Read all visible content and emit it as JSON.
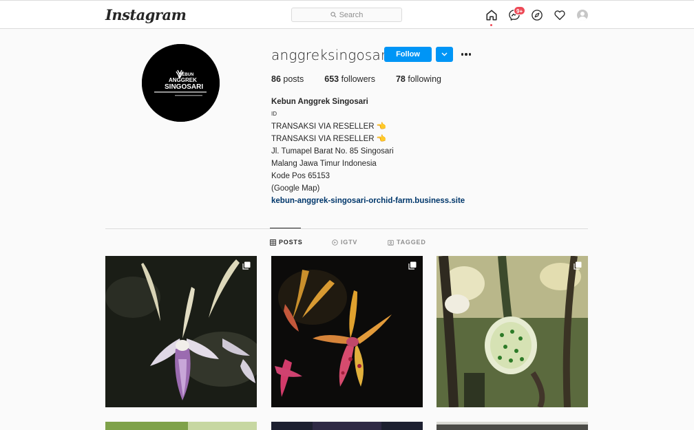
{
  "nav": {
    "logo": "Instagram",
    "search_placeholder": "Search",
    "messages_badge": "9+"
  },
  "profile": {
    "username": "anggreksingosari",
    "follow_label": "Follow",
    "logo_line1": "KEBUN",
    "logo_line2": "ANGGREK",
    "logo_line3": "SINGOSARI",
    "stats": {
      "posts_count": "86",
      "posts_label": "posts",
      "followers_count": "653",
      "followers_label": "followers",
      "following_count": "78",
      "following_label": "following"
    },
    "bio": {
      "name": "Kebun Anggrek Singosari",
      "language": "ID",
      "line1": "TRANSAKSI VIA RESELLER 👈",
      "line2": "TRANSAKSI VIA RESELLER 👈",
      "line3": "Jl. Tumapel Barat No. 85 Singosari",
      "line4": "Malang Jawa Timur Indonesia",
      "line5": "Kode Pos 65153",
      "line6": "(Google Map)",
      "link": "kebun-anggrek-singosari-orchid-farm.business.site"
    }
  },
  "tabs": {
    "posts": "POSTS",
    "igtv": "IGTV",
    "tagged": "TAGGED"
  },
  "colors": {
    "accent": "#0095f6",
    "notification": "#ed4956",
    "link": "#00376b"
  }
}
